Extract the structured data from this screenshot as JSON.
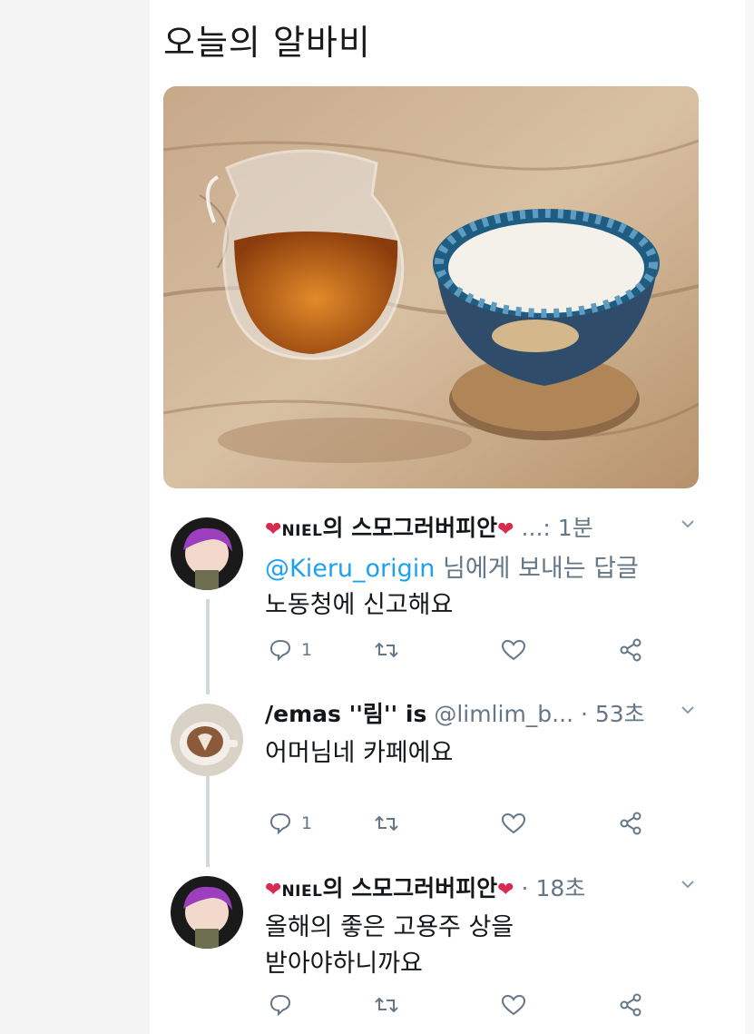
{
  "caption": "오늘의 알바비",
  "tweets": [
    {
      "display_name": "NIEL의 스모그러버피안",
      "name_badge": "NIEL",
      "name_suffix": "의 스모그러버피안",
      "handle": "...",
      "time": "1분",
      "reply_mention": "@Kieru_origin",
      "reply_suffix": " 님에게 보내는 답글",
      "text_lines": [
        "노동청에 신고해요"
      ],
      "reply_count": "1"
    },
    {
      "display_name": "/emas ''림'' is",
      "handle": "@limlim_b...",
      "time": "53초",
      "text_lines": [
        "어머님네 카페에요"
      ],
      "reply_count": "1"
    },
    {
      "display_name": "NIEL의 스모그러버피안",
      "name_badge": "NIEL",
      "name_suffix": "의 스모그러버피안",
      "time": "18초",
      "text_lines": [
        "올해의 좋은 고용주 상을",
        "받아야하니까요"
      ],
      "reply_count": ""
    }
  ],
  "icons": {
    "reply": "reply-icon",
    "retweet": "retweet-icon",
    "like": "like-icon",
    "share": "share-icon",
    "more": "chevron-down-icon"
  },
  "colors": {
    "accent": "#1da1f2",
    "muted": "#657786",
    "heart": "#d62a4e"
  }
}
